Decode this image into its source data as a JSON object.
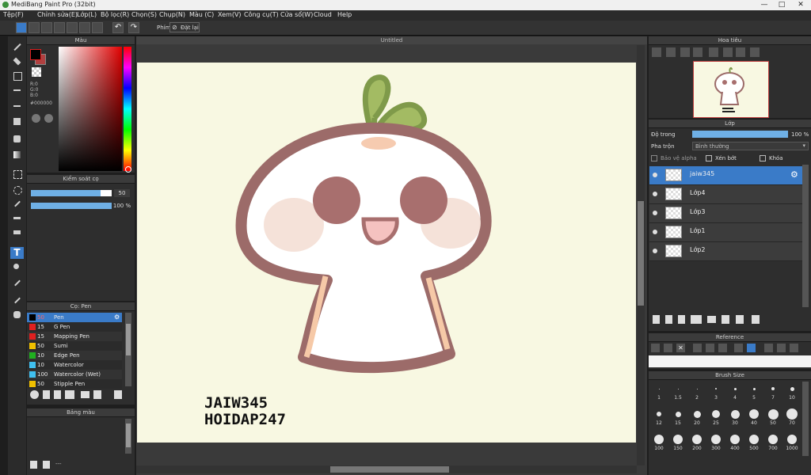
{
  "window": {
    "title": "MediBang Paint Pro (32bit)"
  },
  "menu": [
    "Tệp(F)",
    "Chỉnh sửa(E)",
    "Lớp(L)",
    "Bộ lọc(R)",
    "Chọn(S)",
    "Chụp(N)",
    "Màu (C)",
    "Xem(V)",
    "Công cụ(T)",
    "Cửa sổ(W)",
    "Cloud",
    "Help"
  ],
  "toolbar": {
    "shortcut_label": "Phím",
    "reset_label": "Đặt lại"
  },
  "color_panel": {
    "title": "Màu",
    "r": "R:0",
    "g": "G:0",
    "b": "B:0",
    "hex": "#000000"
  },
  "brush_control": {
    "title": "Kiểm soát cọ",
    "size_value": "50",
    "opacity_value": "100 %",
    "size_fraction": 0.86,
    "opacity_fraction": 1.0
  },
  "brush_panel": {
    "title": "Cọ: Pen",
    "items": [
      {
        "size": "50",
        "name": "Pen",
        "color": "#000000",
        "selected": true
      },
      {
        "size": "15",
        "name": "G Pen",
        "color": "#e02020"
      },
      {
        "size": "15",
        "name": "Mapping Pen",
        "color": "#e02020"
      },
      {
        "size": "50",
        "name": "Sumi",
        "color": "#f0c000"
      },
      {
        "size": "10",
        "name": "Edge Pen",
        "color": "#20b020"
      },
      {
        "size": "10",
        "name": "Watercolor",
        "color": "#40c0f0"
      },
      {
        "size": "100",
        "name": "Watercolor (Wet)",
        "color": "#40c0f0"
      },
      {
        "size": "50",
        "name": "Stipple Pen",
        "color": "#f0c000"
      }
    ]
  },
  "palette_panel": {
    "title": "Bảng màu",
    "footer": "---"
  },
  "canvas": {
    "tab_title": "Untitled",
    "text_line1": "JAIW345",
    "text_line2": "HOIDAP247",
    "background": "#f8f8e2"
  },
  "navigator": {
    "title": "Hoa tiêu"
  },
  "layer_panel": {
    "title": "Lớp",
    "opacity_label": "Độ trong",
    "opacity_value": "100 %",
    "blend_label": "Pha trộn",
    "blend_value": "Bình thường",
    "protect_alpha": "Bảo vệ alpha",
    "clipping": "Xén bớt",
    "lock": "Khóa",
    "layers": [
      {
        "name": "jaiw345",
        "selected": true
      },
      {
        "name": "Lớp4"
      },
      {
        "name": "Lớp3"
      },
      {
        "name": "Lớp1"
      },
      {
        "name": "Lớp2"
      }
    ]
  },
  "reference_panel": {
    "title": "Reference"
  },
  "brush_size_panel": {
    "title": "Brush Size",
    "sizes": [
      "1",
      "1.5",
      "2",
      "3",
      "4",
      "5",
      "7",
      "10",
      "12",
      "15",
      "20",
      "25",
      "30",
      "40",
      "50",
      "70",
      "100",
      "150",
      "200",
      "300",
      "400",
      "500",
      "700",
      "1000"
    ]
  },
  "colors": {
    "accent": "#3a7bc8",
    "character_outline": "#9c6b69",
    "leaf": "#7f9a4a"
  }
}
